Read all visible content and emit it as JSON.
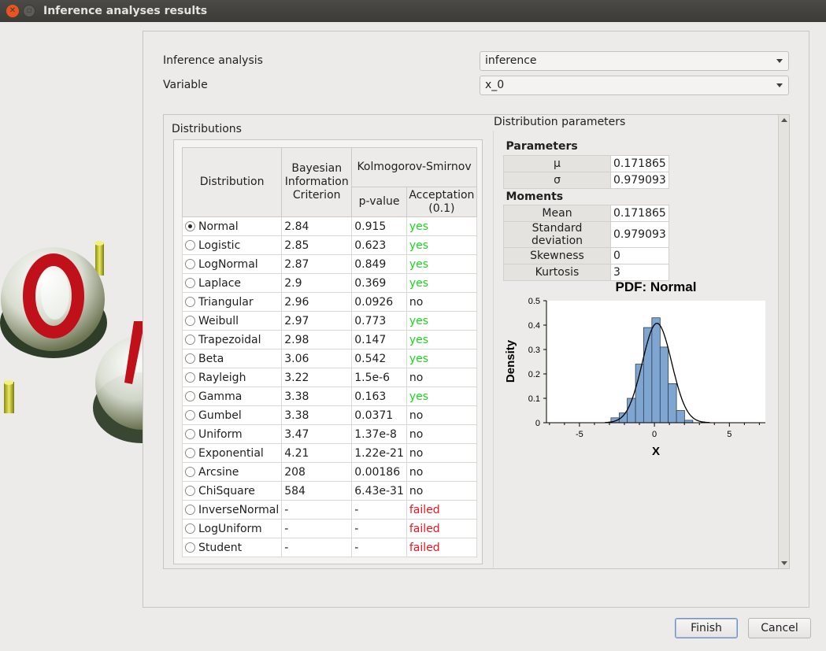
{
  "window": {
    "title": "Inference analyses results"
  },
  "form": {
    "analysis_label": "Inference analysis",
    "analysis_value": "inference",
    "variable_label": "Variable",
    "variable_value": "x_0"
  },
  "distributions": {
    "title": "Distributions",
    "headers": {
      "distribution": "Distribution",
      "bic": "Bayesian Information Criterion",
      "ks": "Kolmogorov-Smirnov",
      "pvalue": "p-value",
      "acceptance": "Acceptation (0.1)"
    },
    "rows": [
      {
        "name": "Normal",
        "bic": "2.84",
        "p": "0.915",
        "acc": "yes",
        "selected": true
      },
      {
        "name": "Logistic",
        "bic": "2.85",
        "p": "0.623",
        "acc": "yes"
      },
      {
        "name": "LogNormal",
        "bic": "2.87",
        "p": "0.849",
        "acc": "yes"
      },
      {
        "name": "Laplace",
        "bic": "2.9",
        "p": "0.369",
        "acc": "yes"
      },
      {
        "name": "Triangular",
        "bic": "2.96",
        "p": "0.0926",
        "acc": "no"
      },
      {
        "name": "Weibull",
        "bic": "2.97",
        "p": "0.773",
        "acc": "yes"
      },
      {
        "name": "Trapezoidal",
        "bic": "2.98",
        "p": "0.147",
        "acc": "yes"
      },
      {
        "name": "Beta",
        "bic": "3.06",
        "p": "0.542",
        "acc": "yes"
      },
      {
        "name": "Rayleigh",
        "bic": "3.22",
        "p": "1.5e-6",
        "acc": "no"
      },
      {
        "name": "Gamma",
        "bic": "3.38",
        "p": "0.163",
        "acc": "yes"
      },
      {
        "name": "Gumbel",
        "bic": "3.38",
        "p": "0.0371",
        "acc": "no"
      },
      {
        "name": "Uniform",
        "bic": "3.47",
        "p": "1.37e-8",
        "acc": "no"
      },
      {
        "name": "Exponential",
        "bic": "4.21",
        "p": "1.22e-21",
        "acc": "no"
      },
      {
        "name": "Arcsine",
        "bic": "208",
        "p": "0.00186",
        "acc": "no"
      },
      {
        "name": "ChiSquare",
        "bic": "584",
        "p": "6.43e-31",
        "acc": "no"
      },
      {
        "name": "InverseNormal",
        "bic": "-",
        "p": "-",
        "acc": "failed"
      },
      {
        "name": "LogUniform",
        "bic": "-",
        "p": "-",
        "acc": "failed"
      },
      {
        "name": "Student",
        "bic": "-",
        "p": "-",
        "acc": "failed"
      }
    ]
  },
  "parameters": {
    "title": "Distribution parameters",
    "params_header": "Parameters",
    "params": [
      {
        "label": "μ",
        "value": "0.171865"
      },
      {
        "label": "σ",
        "value": "0.979093"
      }
    ],
    "moments_header": "Moments",
    "moments": [
      {
        "label": "Mean",
        "value": "0.171865"
      },
      {
        "label": "Standard deviation",
        "value": "0.979093"
      },
      {
        "label": "Skewness",
        "value": "0"
      },
      {
        "label": "Kurtosis",
        "value": "3"
      }
    ]
  },
  "chart_data": {
    "type": "bar",
    "title": "PDF: Normal",
    "xlabel": "X",
    "ylabel": "Density",
    "xlim": [
      -7.2,
      7.4
    ],
    "ylim": [
      0,
      0.5
    ],
    "xticks": [
      "-5",
      "0",
      "5"
    ],
    "xtick_values": [
      -5,
      0,
      5
    ],
    "yticks": [
      "0",
      "0.1",
      "0.2",
      "0.3",
      "0.4",
      "0.5"
    ],
    "ytick_values": [
      0,
      0.1,
      0.2,
      0.3,
      0.4,
      0.5
    ],
    "bin_edges": [
      -2.9,
      -2.35,
      -1.81,
      -1.26,
      -0.72,
      -0.17,
      0.38,
      0.92,
      1.47,
      2.01,
      2.56
    ],
    "values": [
      0.02,
      0.04,
      0.1,
      0.24,
      0.39,
      0.43,
      0.31,
      0.16,
      0.05,
      0.01
    ],
    "series": [
      {
        "kind": "histogram",
        "color": "#7ea6d0"
      },
      {
        "kind": "pdf",
        "mu": 0.171865,
        "sigma": 0.979093,
        "color": "#000000"
      }
    ]
  },
  "buttons": {
    "finish": "Finish",
    "cancel": "Cancel"
  },
  "colors": {
    "accept": "#1ed31e",
    "failed": "#e8141e",
    "bar": "#7ea6d0"
  }
}
